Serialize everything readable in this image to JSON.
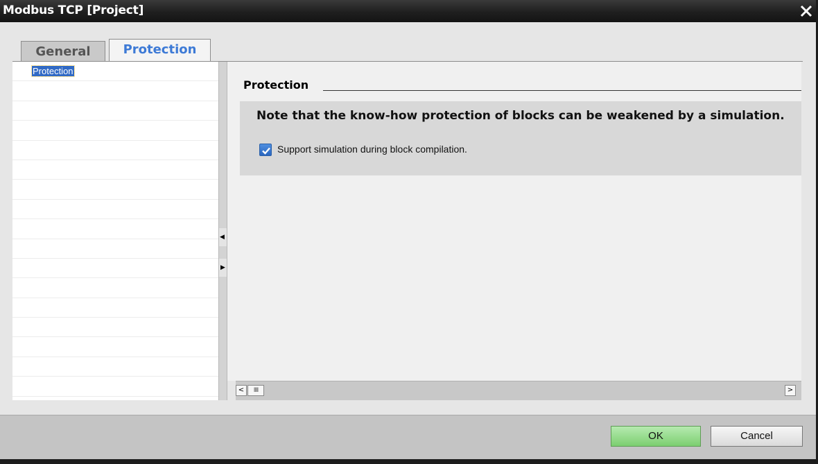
{
  "window": {
    "title": "Modbus TCP [Project]",
    "close_icon": "close-icon"
  },
  "tabs": [
    {
      "label": "General",
      "active": false
    },
    {
      "label": "Protection",
      "active": true
    }
  ],
  "nav": {
    "items": [
      "Protection"
    ],
    "selected_index": 0
  },
  "content": {
    "section_title": "Protection",
    "note": "Note that the know-how protection of blocks can be weakened by a simulation.",
    "checkbox": {
      "label": "Support simulation during block compilation.",
      "checked": true
    }
  },
  "scrollbar": {
    "left_icon": "scroll-left-icon",
    "right_icon": "scroll-right-icon",
    "left_glyph": "<",
    "right_glyph": ">",
    "thumb_glyph": "IIII"
  },
  "footer": {
    "ok_label": "OK",
    "cancel_label": "Cancel"
  },
  "colors": {
    "accent_tab": "#3d7ad6",
    "ok_green": "#7ccf70",
    "selection_blue": "#316ac5"
  }
}
